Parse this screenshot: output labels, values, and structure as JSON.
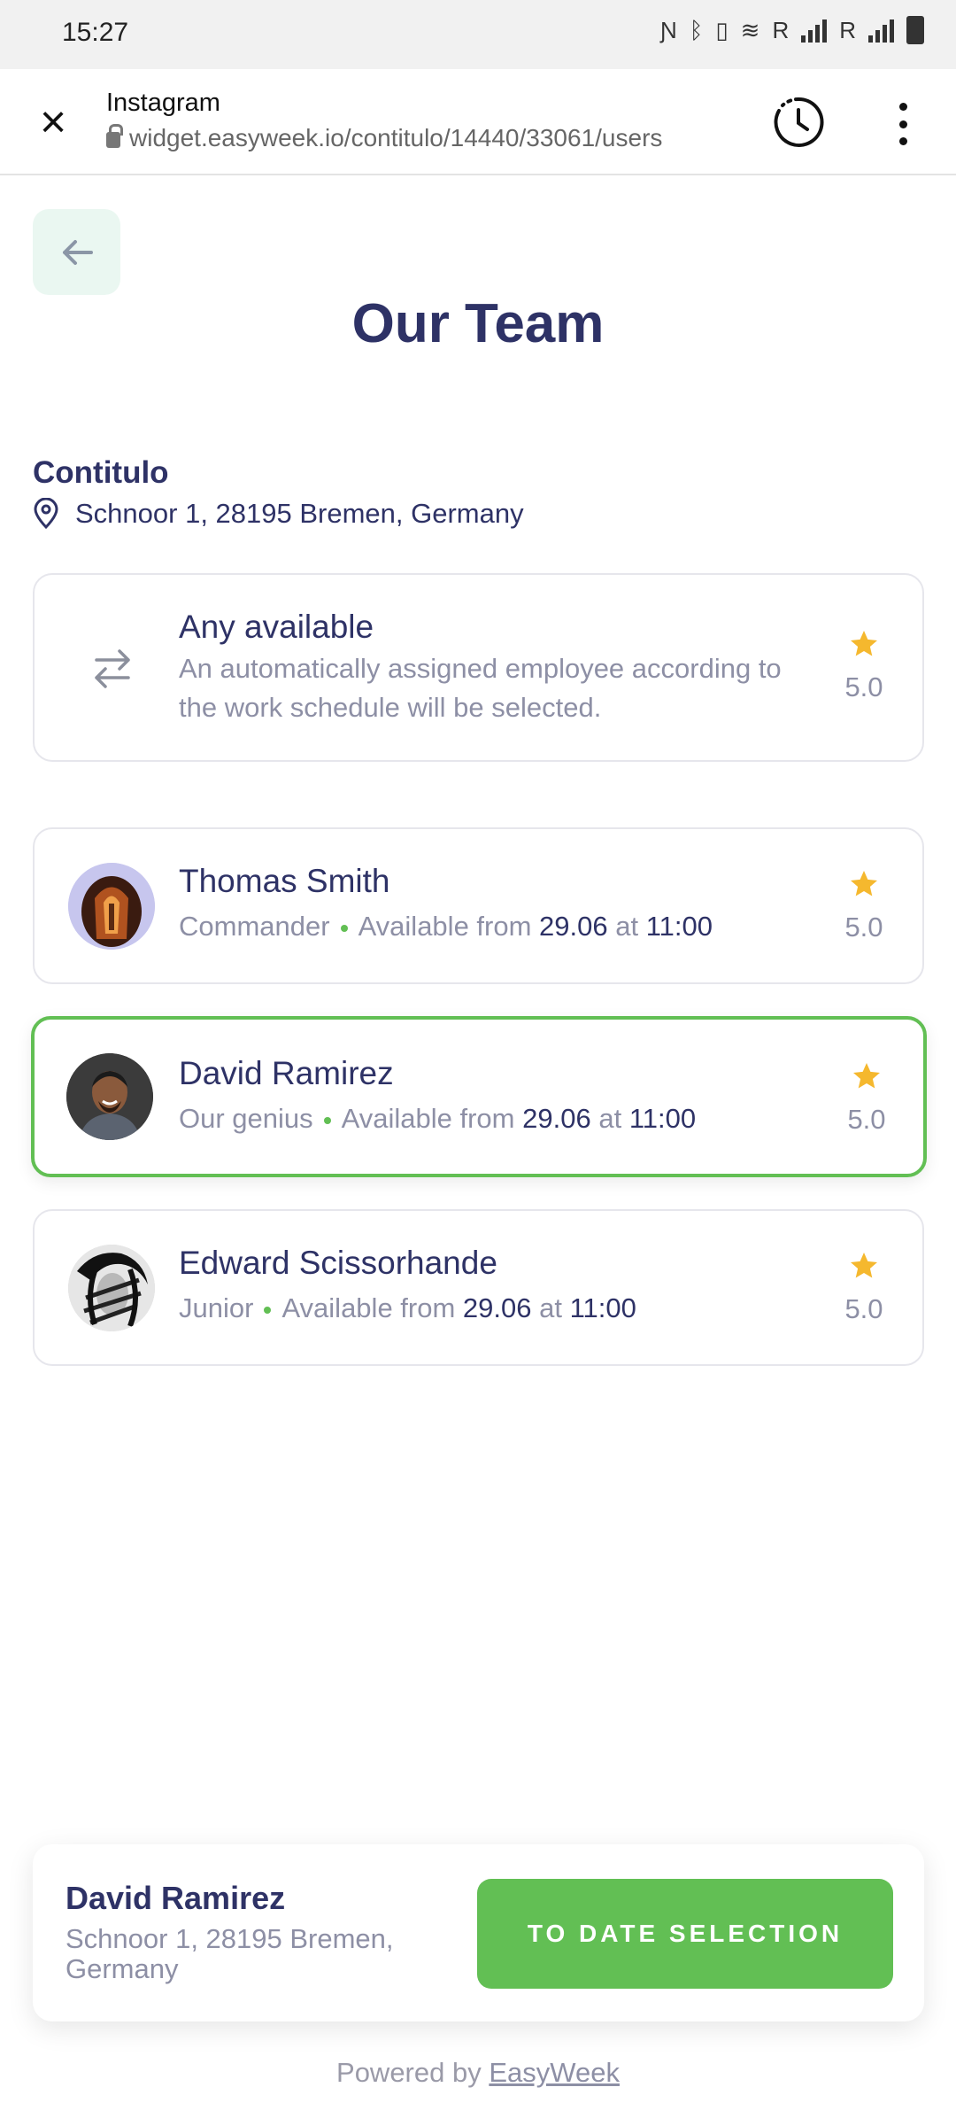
{
  "status_bar": {
    "time": "15:27",
    "carrier1": "R",
    "carrier2": "R"
  },
  "browser": {
    "site_title": "Instagram",
    "url": "widget.easyweek.io/contitulo/14440/33061/users"
  },
  "page": {
    "title": "Our Team",
    "location_name": "Contitulo",
    "location_address": "Schnoor 1, 28195 Bremen, Germany"
  },
  "any_available": {
    "name": "Any available",
    "description": "An automatically assigned employee according to the work schedule will be selected.",
    "rating": "5.0"
  },
  "employees": [
    {
      "name": "Thomas Smith",
      "role": "Commander",
      "available_label": "Available from",
      "date": "29.06",
      "at": "at",
      "time": "11:00",
      "rating": "5.0",
      "selected": false
    },
    {
      "name": "David Ramirez",
      "role": "Our genius",
      "available_label": "Available from",
      "date": "29.06",
      "at": "at",
      "time": "11:00",
      "rating": "5.0",
      "selected": true
    },
    {
      "name": "Edward Scissorhande",
      "role": "Junior",
      "available_label": "Available from",
      "date": "29.06",
      "at": "at",
      "time": "11:00",
      "rating": "5.0",
      "selected": false
    }
  ],
  "footer": {
    "selected_name": "David Ramirez",
    "selected_address": "Schnoor 1, 28195 Bremen, Germany",
    "button_label": "TO DATE SELECTION",
    "powered_by": "Powered by",
    "brand": "EasyWeek"
  },
  "colors": {
    "accent": "#62bf54",
    "title": "#2e3266",
    "muted": "#8d8fa5",
    "star": "#f5b82e"
  },
  "icons": [
    "close-icon",
    "lock-icon",
    "history-icon",
    "more-icon",
    "arrow-back-icon",
    "location-pin-icon",
    "swap-icon",
    "star-icon"
  ]
}
